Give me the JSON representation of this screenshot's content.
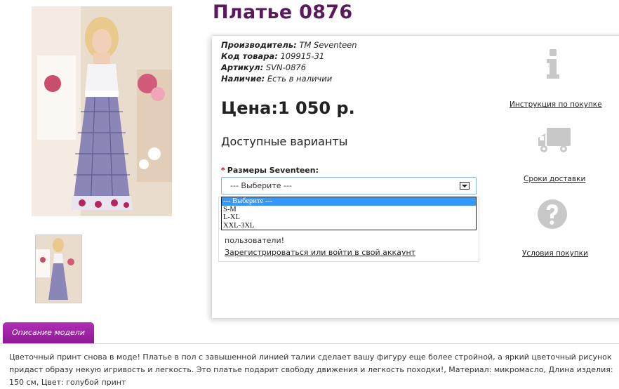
{
  "product": {
    "title": "Платье 0876"
  },
  "specs": [
    {
      "label": "Производитель:",
      "value": "TM Seventeen"
    },
    {
      "label": "Код товара:",
      "value": "109915-31"
    },
    {
      "label": "Артикул:",
      "value": "SVN-0876"
    },
    {
      "label": "Наличие:",
      "value": "Есть в наличии"
    }
  ],
  "price": "Цена:1 050 р.",
  "variants_title": "Доступные варианты",
  "size_select": {
    "required_mark": "*",
    "label": "Размеры Seventeen:",
    "value": "--- Выберите ---",
    "options": [
      "--- Выберите ---",
      "S-M",
      "L-XL",
      "XXL-3XL"
    ],
    "selected_index": 0
  },
  "notice": {
    "text": "пользователи!",
    "link": "Зарегистрироваться или войти в свой аккаунт"
  },
  "side": {
    "instruction": "Инструкция по покупке",
    "delivery": "Сроки доставки",
    "terms": "Условия покупки",
    "info_icon": "info-icon",
    "truck_icon": "truck-icon",
    "question_icon": "question-icon"
  },
  "description": {
    "tab": "Описание модели",
    "text": "Цветочный принт снова в моде! Платье в пол с завышенной линией талии сделает вашу фигуру еще более стройной, а яркий цветочный рисунок придаст образу некую игривость и легкость. Это платье подарит свободу движения и легкость походки!, Материал: микромасло, Длина изделия: 150 см, Цвет: голубой принт"
  },
  "colors": {
    "title": "#5b1a60",
    "tab": "#9c1fa3",
    "selected_option": "#3399ff"
  }
}
